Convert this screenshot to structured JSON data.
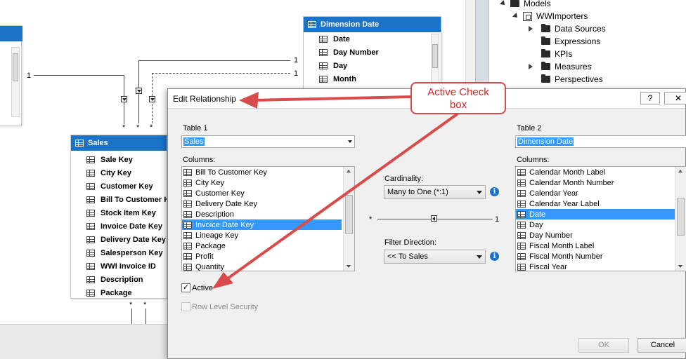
{
  "diagram": {
    "dimension_date": {
      "title": "Dimension Date",
      "fields": [
        "Date",
        "Day Number",
        "Day",
        "Month"
      ]
    },
    "sales": {
      "title": "Sales",
      "fields": [
        "Sale Key",
        "City Key",
        "Customer Key",
        "Bill To Customer Key",
        "Stock Item Key",
        "Invoice Date Key",
        "Delivery Date Key",
        "Salesperson Key",
        "WWI Invoice ID",
        "Description",
        "Package"
      ]
    },
    "relation_labels": {
      "one": "1",
      "many": "*"
    }
  },
  "explorer": {
    "items": [
      {
        "label": "Models"
      },
      {
        "label": "WWImporters"
      },
      {
        "label": "Data Sources"
      },
      {
        "label": "Expressions"
      },
      {
        "label": "KPIs"
      },
      {
        "label": "Measures"
      },
      {
        "label": "Perspectives"
      }
    ]
  },
  "dialog": {
    "title": "Edit Relationship",
    "help_label": "?",
    "close_label": "✕",
    "table1": {
      "label": "Table 1",
      "value": "Sales",
      "columns_label": "Columns:",
      "columns": [
        "Bill To Customer Key",
        "City Key",
        "Customer Key",
        "Delivery Date Key",
        "Description",
        "Invoice Date Key",
        "Lineage Key",
        "Package",
        "Profit",
        "Quantity"
      ],
      "selected": "Invoice Date Key"
    },
    "table2": {
      "label": "Table 2",
      "value": "Dimension Date",
      "columns_label": "Columns:",
      "columns": [
        "Calendar Month Label",
        "Calendar Month Number",
        "Calendar Year",
        "Calendar Year Label",
        "Date",
        "Day",
        "Day Number",
        "Fiscal Month Label",
        "Fiscal Month Number",
        "Fiscal Year"
      ],
      "selected": "Date"
    },
    "cardinality": {
      "label": "Cardinality:",
      "value": "Many to One (*:1)"
    },
    "filter_direction": {
      "label": "Filter Direction:",
      "value": "<< To Sales"
    },
    "relation_many": "*",
    "relation_one": "1",
    "active": {
      "label": "Active",
      "checked": true
    },
    "row_level_security": {
      "label": "Row Level Security",
      "checked": false
    },
    "ok_label": "OK",
    "cancel_label": "Cancel"
  },
  "callout": {
    "line1": "Active Check",
    "line2": "box"
  },
  "colors": {
    "accent": "#1a73c6",
    "selection": "#3399ff",
    "annotation": "#d94a4a"
  }
}
